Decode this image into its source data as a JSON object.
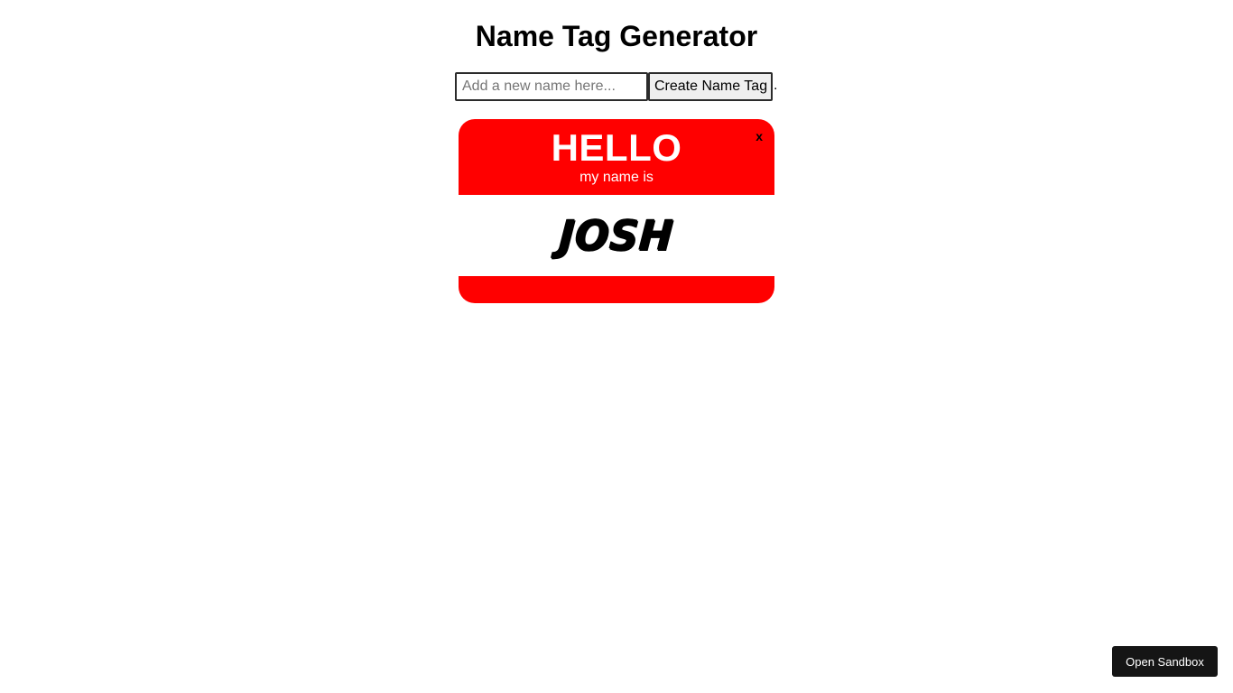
{
  "header": {
    "title": "Name Tag Generator"
  },
  "form": {
    "input_placeholder": "Add a new name here...",
    "input_value": "",
    "create_label": "Create Name Tag",
    "trailing_text": "."
  },
  "name_tags": [
    {
      "hello": "HELLO",
      "subtitle": "my name is",
      "name": "JOSH",
      "close_label": "x"
    }
  ],
  "footer": {
    "open_sandbox_label": "Open Sandbox"
  },
  "colors": {
    "tag_red": "#ff0000",
    "sandbox_button_bg": "#151515"
  }
}
